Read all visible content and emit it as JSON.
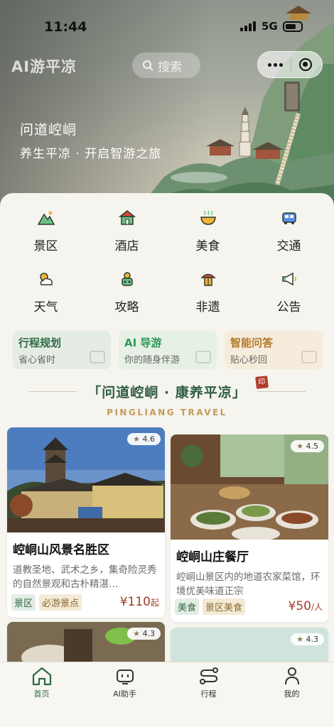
{
  "status": {
    "time": "11:44",
    "network": "5G"
  },
  "header": {
    "app_title": "AI游平凉",
    "search_placeholder": "搜索"
  },
  "hero": {
    "title": "问道崆峒",
    "subtitle": "养生平凉 · 开启智游之旅"
  },
  "categories": [
    {
      "label": "景区",
      "icon": "mountain-icon"
    },
    {
      "label": "酒店",
      "icon": "hotel-icon"
    },
    {
      "label": "美食",
      "icon": "food-bowl-icon"
    },
    {
      "label": "交通",
      "icon": "bus-icon"
    },
    {
      "label": "天气",
      "icon": "weather-icon"
    },
    {
      "label": "攻略",
      "icon": "guide-icon"
    },
    {
      "label": "非遗",
      "icon": "heritage-icon"
    },
    {
      "label": "公告",
      "icon": "megaphone-icon"
    }
  ],
  "features": [
    {
      "title": "行程规划",
      "sub": "省心省时",
      "color": "#2f6a45"
    },
    {
      "title": "AI 导游",
      "sub": "你的随身伴游",
      "color": "#2f9a55"
    },
    {
      "title": "智能问答",
      "sub": "贴心秒回",
      "color": "#b07a2a"
    }
  ],
  "banner": {
    "text": "「问道崆峒 · 康养平凉」",
    "seal": "印",
    "english": "PINGLIANG TRAVEL"
  },
  "cards": [
    {
      "rating": "4.6",
      "name": "崆峒山风景名胜区",
      "desc": "道教圣地、武术之乡，集奇险灵秀的自然景观和古朴精湛…",
      "tags": [
        "景区",
        "必游景点"
      ],
      "price": "¥110",
      "price_unit": "起"
    },
    {
      "rating": "4.5",
      "name": "崆峒山庄餐厅",
      "desc": "崆峒山景区内的地道农家菜馆，环境优美味道正宗",
      "tags": [
        "美食",
        "景区美食"
      ],
      "price": "¥50",
      "price_unit": "/人"
    },
    {
      "rating": "4.3"
    },
    {
      "rating": "4.3"
    }
  ],
  "tabs": [
    {
      "label": "首页",
      "icon": "home-icon",
      "active": true
    },
    {
      "label": "AI助手",
      "icon": "robot-icon",
      "active": false
    },
    {
      "label": "行程",
      "icon": "route-icon",
      "active": false
    },
    {
      "label": "我的",
      "icon": "user-icon",
      "active": false
    }
  ],
  "colors": {
    "accent": "#2f6a45",
    "price": "#a13d2b",
    "panel": "#f6f4ee"
  }
}
